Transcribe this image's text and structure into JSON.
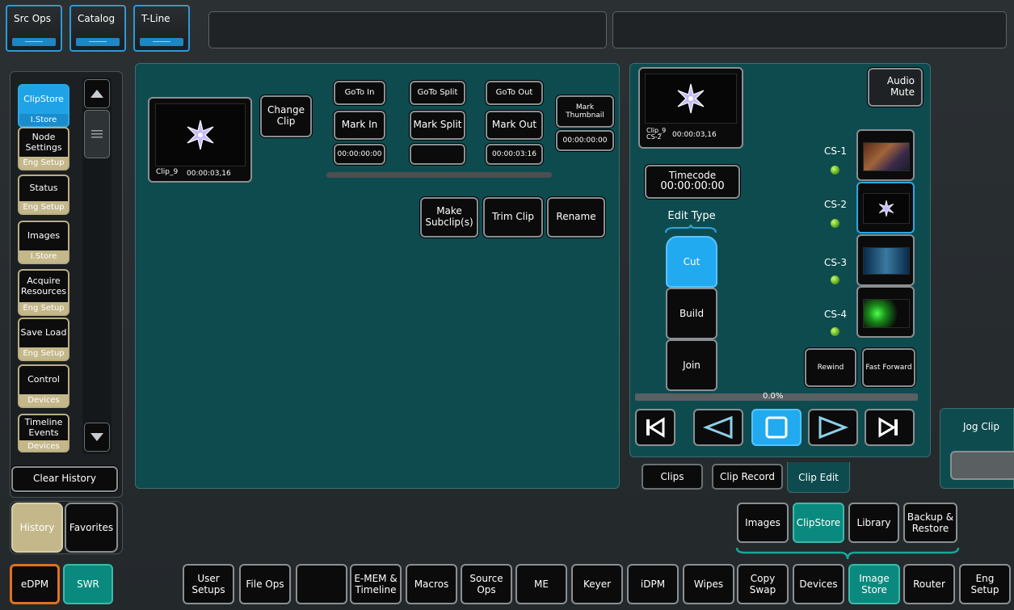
{
  "top_tabs": [
    {
      "label": "Src Ops"
    },
    {
      "label": "Catalog"
    },
    {
      "label": "T-Line"
    }
  ],
  "sidebar": {
    "items": [
      {
        "label": "ClipStore",
        "sub": "I.Store"
      },
      {
        "label": "Node Settings",
        "sub": "Eng Setup"
      },
      {
        "label": "Status",
        "sub": "Eng Setup"
      },
      {
        "label": "Images",
        "sub": "I.Store"
      },
      {
        "label": "Acquire Resources",
        "sub": "Eng Setup"
      },
      {
        "label": "Save Load",
        "sub": "Eng Setup"
      },
      {
        "label": "Control",
        "sub": "Devices"
      },
      {
        "label": "Timeline Events",
        "sub": "Devices"
      }
    ],
    "clear_history": "Clear History",
    "history_tab": "History",
    "favorites_tab": "Favorites"
  },
  "clip_panel": {
    "clip_name": "Clip_9",
    "clip_duration": "00:00:03,16",
    "change_clip": "Change Clip",
    "goto_in": "GoTo In",
    "goto_split": "GoTo Split",
    "goto_out": "GoTo Out",
    "mark_in": "Mark In",
    "mark_split": "Mark Split",
    "mark_out": "Mark Out",
    "mark_thumbnail": "Mark Thumbnail",
    "in_time": "00:00:00:00",
    "split_time": "",
    "out_time": "00:00:03:16",
    "thumbnail_time": "00:00:00:00",
    "make_subclip": "Make Subclip(s)",
    "trim_clip": "Trim Clip",
    "rename": "Rename"
  },
  "player": {
    "preview_clip": "Clip_9",
    "preview_channel": "CS-2",
    "preview_duration": "00:00:03,16",
    "audio_mute": "Audio Mute",
    "timecode_label": "Timecode",
    "timecode_value": "00:00:00:00",
    "edit_type_label": "Edit Type",
    "edit_types": [
      "Cut",
      "Build",
      "Join"
    ],
    "channels": [
      "CS-1",
      "CS-2",
      "CS-3",
      "CS-4"
    ],
    "rewind": "Rewind",
    "fast_forward": "Fast Forward",
    "progress_text": "0.0%",
    "progress_fraction": 0.0,
    "tabs": [
      "Clips",
      "Clip Record",
      "Clip Edit"
    ],
    "jog_clip": "Jog Clip"
  },
  "mid_row": [
    {
      "label": "Images"
    },
    {
      "label": "ClipStore"
    },
    {
      "label": "Library"
    },
    {
      "label": "Backup & Restore"
    }
  ],
  "bottom_row": [
    {
      "label": "eDPM"
    },
    {
      "label": "SWR"
    },
    {
      "label": "User Setups"
    },
    {
      "label": "File Ops"
    },
    {
      "label": ""
    },
    {
      "label": "E-MEM & Timeline"
    },
    {
      "label": "Macros"
    },
    {
      "label": "Source Ops"
    },
    {
      "label": "ME"
    },
    {
      "label": "Keyer"
    },
    {
      "label": "iDPM"
    },
    {
      "label": "Wipes"
    },
    {
      "label": "Copy Swap"
    },
    {
      "label": "Devices"
    },
    {
      "label": "Image Store"
    },
    {
      "label": "Router"
    },
    {
      "label": "Eng Setup"
    }
  ],
  "colors": {
    "accent_blue": "#22aaf0",
    "panel_teal": "#0e4b4f",
    "selected_teal": "#0a8a7e",
    "history_tan": "#c4b88b"
  }
}
